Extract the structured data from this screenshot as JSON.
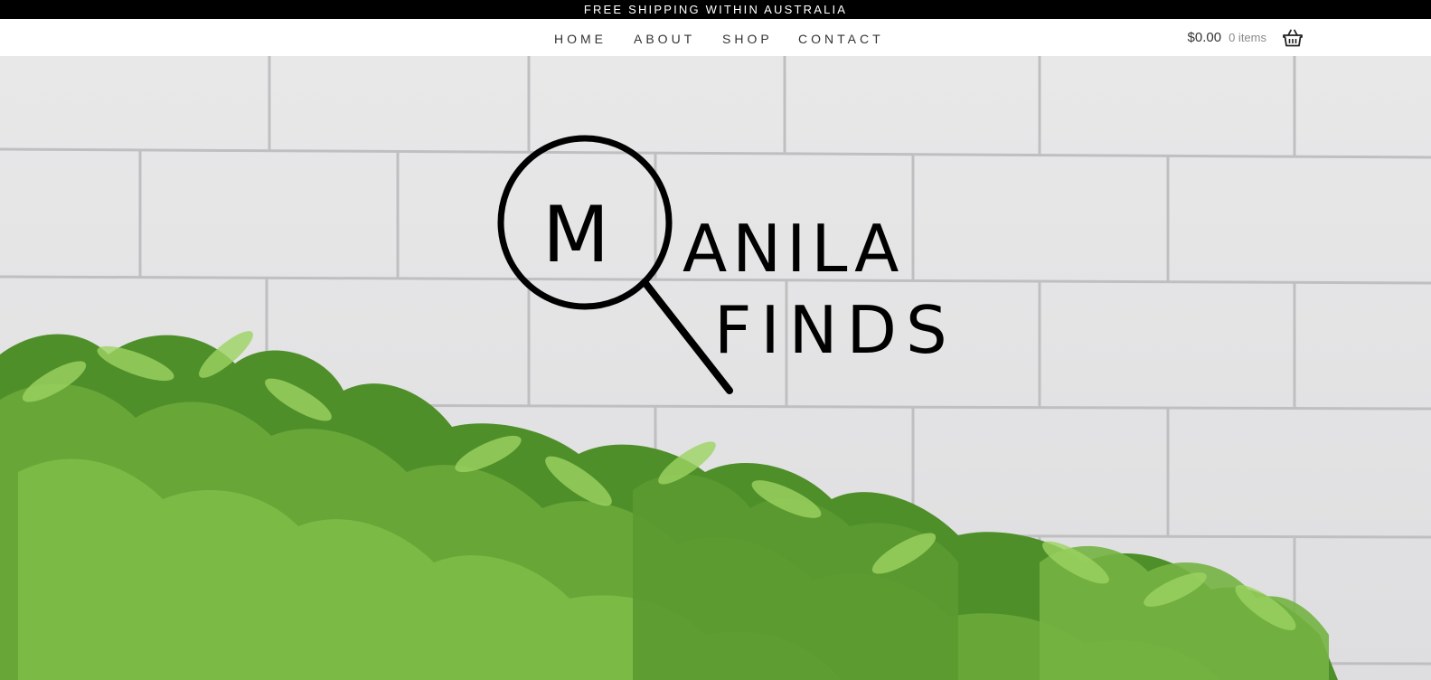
{
  "announcement": {
    "text": "FREE SHIPPING WITHIN AUSTRALIA"
  },
  "nav": {
    "items": [
      {
        "label": "HOME"
      },
      {
        "label": "ABOUT"
      },
      {
        "label": "SHOP"
      },
      {
        "label": "CONTACT"
      }
    ]
  },
  "cart": {
    "amount": "$0.00",
    "count": "0 items",
    "icon": "basket-icon"
  },
  "hero": {
    "logo": {
      "line1_initial": "M",
      "line1_rest": "ANILA",
      "line2": "FINDS",
      "icon": "magnifying-glass-icon"
    }
  },
  "colors": {
    "topbar": "#000000",
    "wall": "#e5e5e6",
    "mortar": "#bdbdbf",
    "foliage": "#5e9f2f",
    "text": "#333333"
  }
}
